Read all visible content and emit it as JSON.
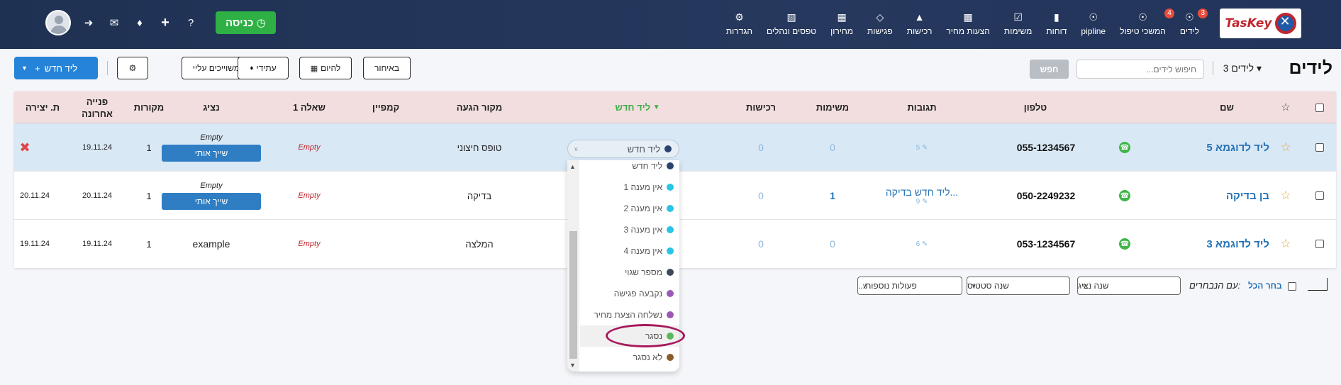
{
  "nav": {
    "logo": "TasKey",
    "items": [
      {
        "label": "לידים",
        "icon": "user-icon",
        "badge": "3"
      },
      {
        "label": "המשכי טיפול",
        "icon": "user-icon",
        "badge": "4"
      },
      {
        "label": "pipline",
        "icon": "user-icon",
        "badge": ""
      },
      {
        "label": "דוחות",
        "icon": "bar-chart-icon",
        "badge": ""
      },
      {
        "label": "משימות",
        "icon": "checkbox-icon",
        "badge": ""
      },
      {
        "label": "הצעות מחיר",
        "icon": "document-icon",
        "badge": ""
      },
      {
        "label": "רכישות",
        "icon": "cart-icon",
        "badge": ""
      },
      {
        "label": "פגישות",
        "icon": "handshake-icon",
        "badge": ""
      },
      {
        "label": "מחירון",
        "icon": "barcode-icon",
        "badge": ""
      },
      {
        "label": "טפסים ונהלים",
        "icon": "book-icon",
        "badge": ""
      },
      {
        "label": "הגדרות",
        "icon": "gear-icon",
        "badge": ""
      }
    ],
    "checkin_label": "כניסה"
  },
  "toolbar": {
    "page_title": "לידים",
    "leads_count": "3 לידים",
    "search_placeholder": "חיפוש לידים...",
    "search_button": "חפש",
    "add_lead": "ליד חדש",
    "assigned_to_me": "משוייכים עליי",
    "future": "עתידי",
    "today": "להיום",
    "late": "באיחור"
  },
  "table": {
    "headers": {
      "name": "שם",
      "phone": "טלפון",
      "responses": "תגובות",
      "tasks": "משימות",
      "purchases": "רכישות",
      "status": "ליד חדש",
      "source": "מקור הגעה",
      "campaign": "קמפיין",
      "question1": "שאלה 1",
      "rep": "נציג",
      "sources": "מקורות",
      "last_contact": "פנייה אחרונה",
      "created": "ת. יצירה"
    },
    "rows": [
      {
        "name": "ליד לדוגמא 5",
        "phone": "055-1234567",
        "responses": "5",
        "tasks": "0",
        "purchases": "0",
        "status": "ליד חדש",
        "source": "טופס חיצוני",
        "question1": "Empty",
        "rep": "Empty",
        "assign_button": "שייך אותי",
        "sources": "1",
        "last_contact": "19.11.24",
        "created": ""
      },
      {
        "name": "בן בדיקה",
        "phone": "050-2249232",
        "responses_text": "ליד חדש בדיקה...",
        "responses": "9",
        "tasks": "1",
        "purchases": "0",
        "source": "בדיקה",
        "question1": "Empty",
        "rep": "Empty",
        "assign_button": "שייך אותי",
        "sources": "1",
        "last_contact": "20.11.24",
        "created": "20.11.24"
      },
      {
        "name": "ליד לדוגמא 3",
        "phone": "053-1234567",
        "responses": "6",
        "tasks": "0",
        "purchases": "0",
        "source": "המלצה",
        "question1": "Empty",
        "rep": "example",
        "sources": "1",
        "last_contact": "19.11.24",
        "created": "19.11.24"
      }
    ]
  },
  "status_dropdown": {
    "selected": "ליד חדש",
    "options": [
      {
        "label": "ליד חדש",
        "color": "#2c4370"
      },
      {
        "label": "אין מענה 1",
        "color": "#29c4e6"
      },
      {
        "label": "אין מענה 2",
        "color": "#29c4e6"
      },
      {
        "label": "אין מענה 3",
        "color": "#29c4e6"
      },
      {
        "label": "אין מענה 4",
        "color": "#29c4e6"
      },
      {
        "label": "מספר שגוי",
        "color": "#3e4a5c"
      },
      {
        "label": "נקבעה פגישה",
        "color": "#9b59b6"
      },
      {
        "label": "נשלחה הצעת מחיר",
        "color": "#9b59b6"
      },
      {
        "label": "נסגר",
        "color": "#5cb85c"
      },
      {
        "label": "לא נסגר",
        "color": "#8b5a2b"
      }
    ]
  },
  "bulk": {
    "select_all": "בחר הכל",
    "with_selected": "עם הנבחרים:",
    "change_rep": "שנה נציג",
    "change_status": "שנה סטטוס",
    "more_actions": "פעולות נוספות..."
  }
}
